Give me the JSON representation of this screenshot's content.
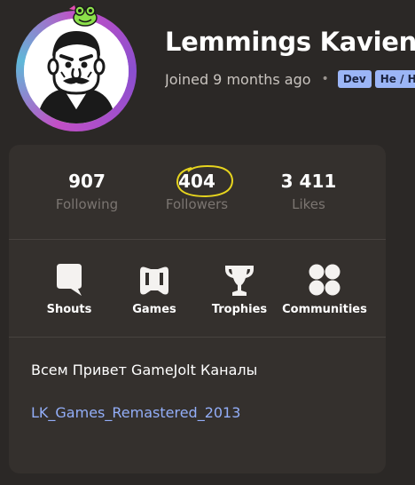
{
  "profile": {
    "name": "Lemmings Kavien",
    "joined": "Joined 9 months ago",
    "separator": "•",
    "tags": [
      "Dev",
      "He / H"
    ]
  },
  "stats": [
    {
      "value": "907",
      "label": "Following"
    },
    {
      "value": "404",
      "label": "Followers"
    },
    {
      "value": "3 411",
      "label": "Likes"
    }
  ],
  "nav": [
    {
      "label": "Shouts",
      "icon": "shouts-icon"
    },
    {
      "label": "Games",
      "icon": "gamepad-icon"
    },
    {
      "label": "Trophies",
      "icon": "trophy-icon"
    },
    {
      "label": "Communities",
      "icon": "communities-icon"
    }
  ],
  "bio": {
    "text": "Всем Привет GameJolt Каналы",
    "link": "LK_Games_Remastered_2013"
  },
  "colors": {
    "background": "#2b2826",
    "card": "#34302d",
    "tag": "#9bb5f6",
    "link": "#93aef8",
    "highlight": "#e6d41e",
    "ring": "#c24fc5"
  }
}
